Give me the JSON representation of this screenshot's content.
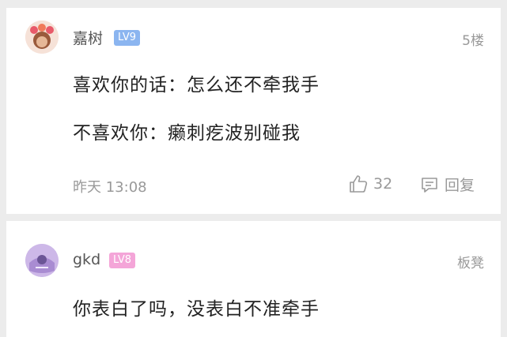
{
  "comments": [
    {
      "username": "嘉树",
      "level": "LV9",
      "level_color": "#8bb5f0",
      "floor": "5楼",
      "lines": [
        "喜欢你的话：怎么还不牵我手",
        "不喜欢你：癞刺疙波别碰我"
      ],
      "time": "昨天 13:08",
      "likes": "32",
      "reply_label": "回复"
    },
    {
      "username": "gkd",
      "level": "LV8",
      "level_color": "#f4a5d8",
      "floor": "板凳",
      "lines": [
        "你表白了吗，没表白不准牵手"
      ]
    }
  ],
  "icons": {
    "like": "thumbs-up-icon",
    "reply": "comment-bubble-icon"
  }
}
